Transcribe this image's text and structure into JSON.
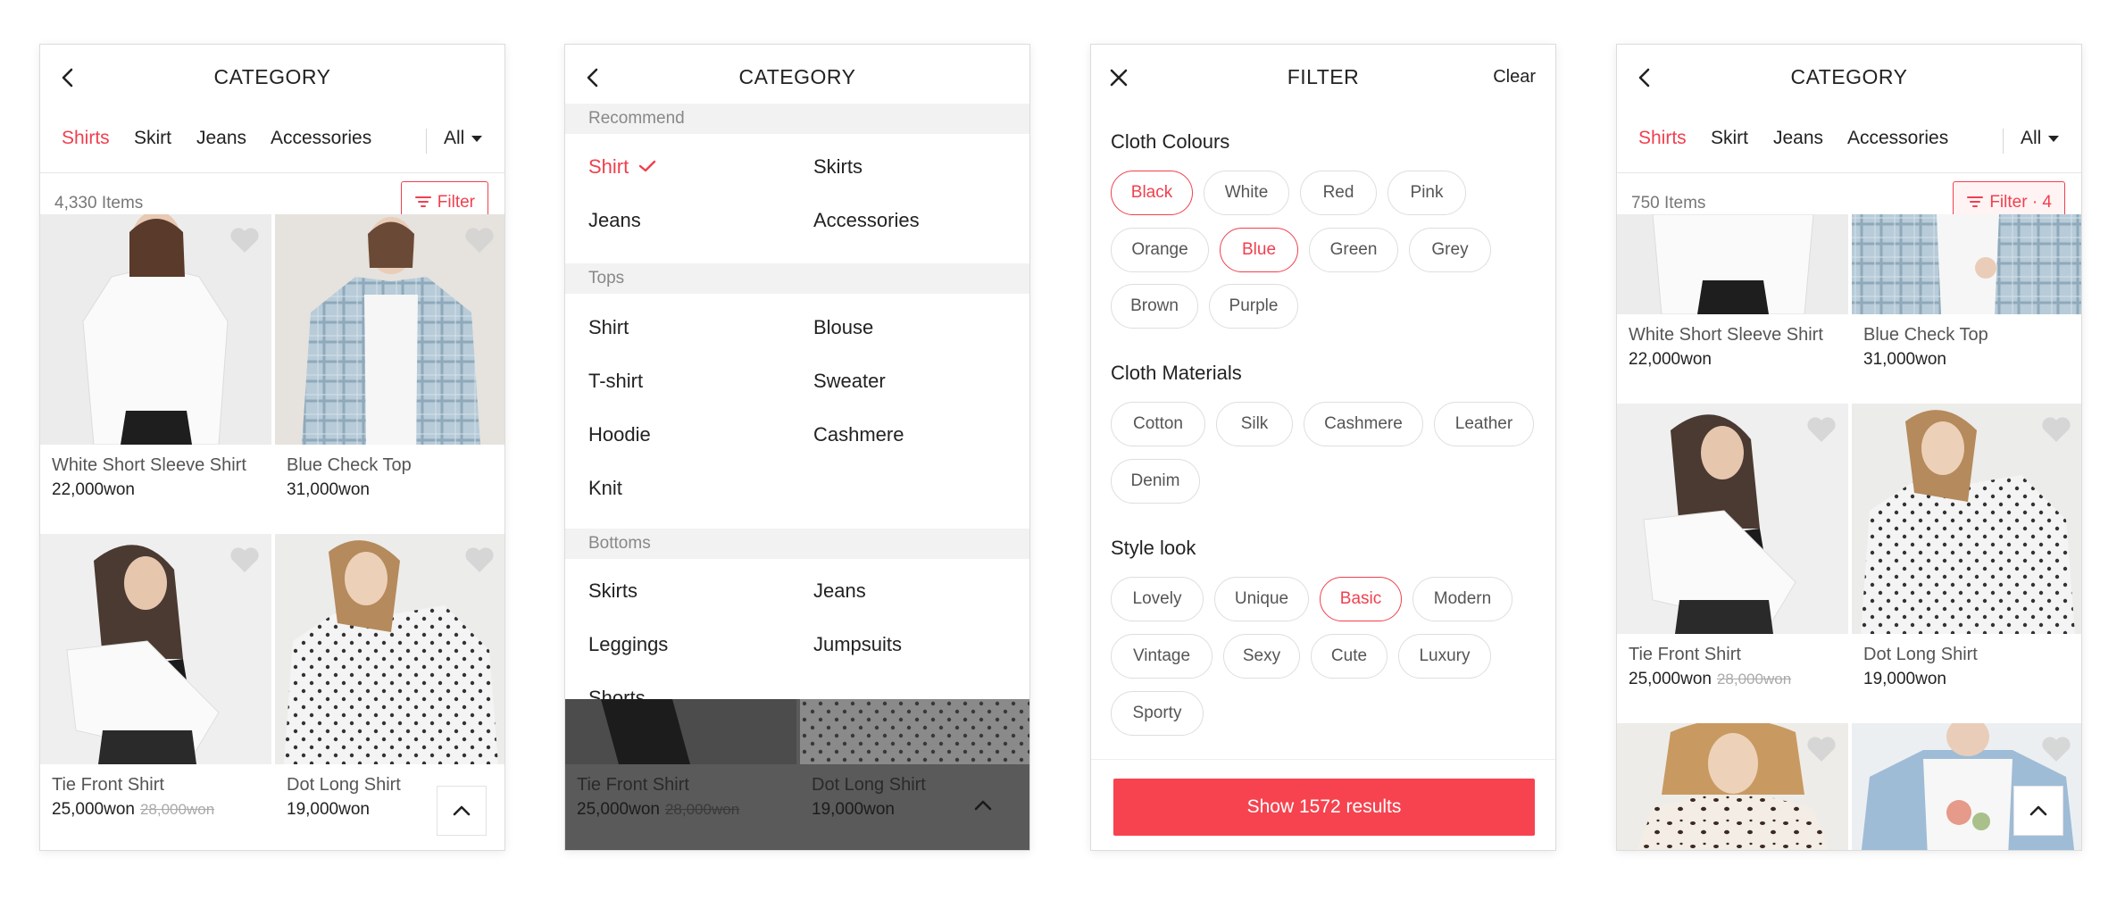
{
  "colors": {
    "accent": "#f0404e",
    "button": "#f6434f"
  },
  "screen1": {
    "title": "CATEGORY",
    "tabs": [
      "Shirts",
      "Skirt",
      "Jeans",
      "Accessories"
    ],
    "active_tab": "Shirts",
    "all_label": "All",
    "item_count": "4,330 Items",
    "filter_label": "Filter",
    "products": [
      {
        "name": "White Short Sleeve Shirt",
        "price": "22,000won",
        "old_price": ""
      },
      {
        "name": "Blue Check Top",
        "price": "31,000won",
        "old_price": ""
      },
      {
        "name": "Tie Front Shirt",
        "price": "25,000won",
        "old_price": "28,000won"
      },
      {
        "name": "Dot Long Shirt",
        "price": "19,000won",
        "old_price": ""
      }
    ]
  },
  "screen2": {
    "title": "CATEGORY",
    "sections": [
      {
        "name": "Recommend",
        "items": [
          "Shirt",
          "Skirts",
          "Jeans",
          "Accessories"
        ],
        "selected": "Shirt"
      },
      {
        "name": "Tops",
        "items": [
          "Shirt",
          "Blouse",
          "T-shirt",
          "Sweater",
          "Hoodie",
          "Cashmere",
          "Knit"
        ]
      },
      {
        "name": "Bottoms",
        "items": [
          "Skirts",
          "Jeans",
          "Leggings",
          "Jumpsuits",
          "Shorts"
        ]
      }
    ],
    "dim_products": [
      {
        "name": "Tie Front Shirt",
        "price": "25,000won",
        "old_price": "28,000won"
      },
      {
        "name": "Dot Long Shirt",
        "price": "19,000won",
        "old_price": ""
      }
    ]
  },
  "screen3": {
    "title": "FILTER",
    "clear_label": "Clear",
    "groups": [
      {
        "title": "Cloth Colours",
        "options": [
          "Black",
          "White",
          "Red",
          "Pink",
          "Orange",
          "Blue",
          "Green",
          "Grey",
          "Brown",
          "Purple"
        ],
        "selected": [
          "Black",
          "Blue"
        ]
      },
      {
        "title": "Cloth Materials",
        "options": [
          "Cotton",
          "Silk",
          "Cashmere",
          "Leather",
          "Denim"
        ],
        "selected": []
      },
      {
        "title": "Style look",
        "options": [
          "Lovely",
          "Unique",
          "Basic",
          "Modern",
          "Vintage",
          "Sexy",
          "Cute",
          "Luxury",
          "Sporty"
        ],
        "selected": [
          "Basic"
        ]
      }
    ],
    "show_button": "Show 1572 results"
  },
  "screen4": {
    "title": "CATEGORY",
    "tabs": [
      "Shirts",
      "Skirt",
      "Jeans",
      "Accessories"
    ],
    "active_tab": "Shirts",
    "all_label": "All",
    "item_count": "750 Items",
    "filter_label": "Filter · 4",
    "products": [
      {
        "name": "White Short Sleeve Shirt",
        "price": "22,000won",
        "old_price": ""
      },
      {
        "name": "Blue Check Top",
        "price": "31,000won",
        "old_price": ""
      },
      {
        "name": "Tie Front Shirt",
        "price": "25,000won",
        "old_price": "28,000won"
      },
      {
        "name": "Dot Long Shirt",
        "price": "19,000won",
        "old_price": ""
      }
    ]
  }
}
